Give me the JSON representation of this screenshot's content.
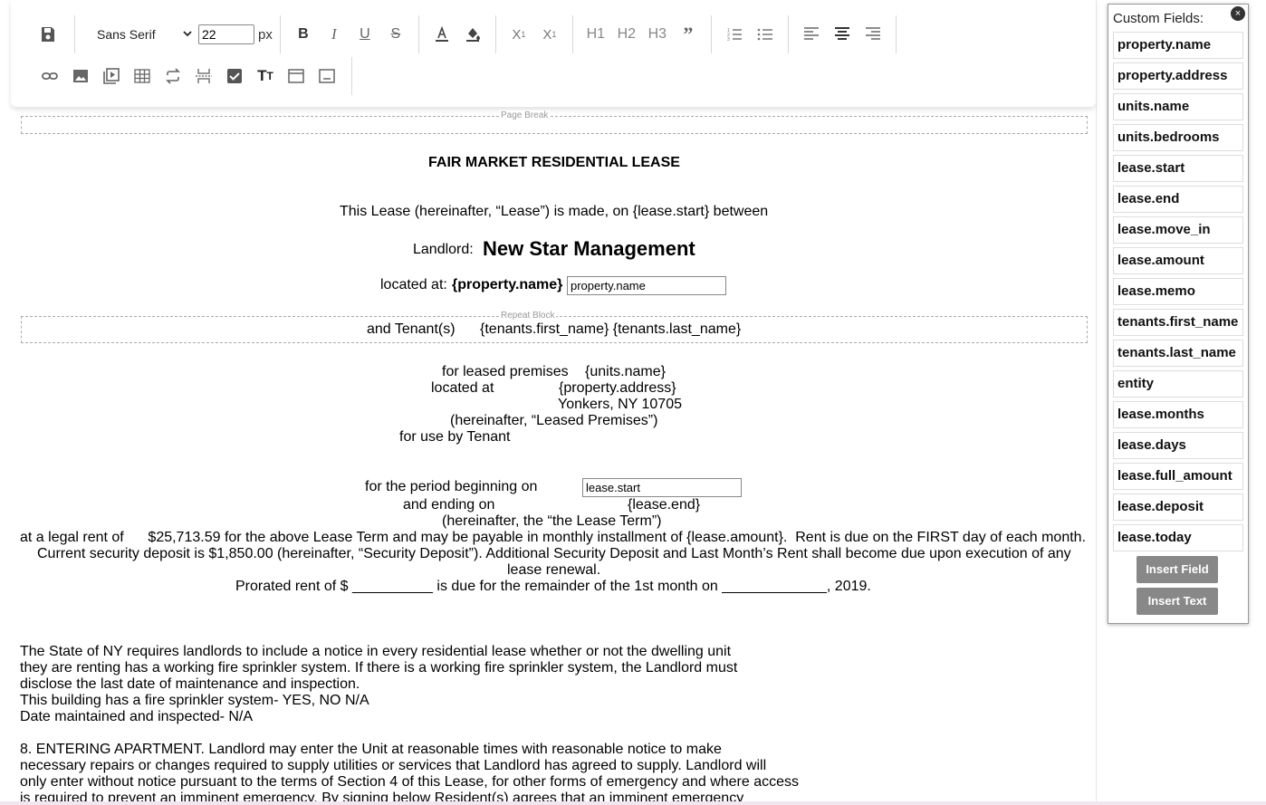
{
  "toolbar": {
    "font_family": "Sans Serif",
    "font_size": "22",
    "font_unit": "px",
    "headings": [
      "H1",
      "H2",
      "H3"
    ]
  },
  "document": {
    "page_break_label": "Page Break",
    "repeat_block_label": "Repeat Block",
    "title": "FAIR MARKET RESIDENTIAL LEASE",
    "intro": "This Lease (hereinafter, “Lease”) is made, on {lease.start} between",
    "landlord_label": "Landlord:",
    "landlord_name": "New Star Management",
    "located_at_label": "located at:",
    "located_at_value": "{property.name}",
    "field_property_name": "property.name",
    "tenants_label": "and Tenant(s)",
    "tenants_value": "{tenants.first_name} {tenants.last_name}",
    "premises_label": "for leased premises",
    "premises_value": "{units.name}",
    "premises_located_label": "located at",
    "premises_address": "{property.address}",
    "premises_city": "Yonkers, NY 10705",
    "premises_hereinafter": "(hereinafter, “Leased Premises”)",
    "premises_use": "for use by Tenant",
    "period_label": "for the period beginning on",
    "field_lease_start": "lease.start",
    "ending_label": "and ending on",
    "ending_value": "{lease.end}",
    "term_hereinafter": "(hereinafter, the “the Lease Term”)",
    "rent_line": "at a legal rent of      $25,713.59 for the above Lease Term and may be payable in monthly installment of {lease.amount}.  Rent is due on the FIRST day of each month.",
    "deposit_line": "Current security deposit is $1,850.00 (hereinafter, “Security Deposit”). Additional Security Deposit and Last Month’s Rent shall become due upon execution of any",
    "deposit_line2": "lease renewal.",
    "prorated_line": "Prorated rent of $ __________ is due for the remainder of the 1st month on _____________, 2019.",
    "sprinkler": [
      "The State of NY requires landlords to include a notice in every residential lease whether or not the dwelling unit",
      "they are renting has a working fire sprinkler system. If there is a working fire sprinkler system, the Landlord must",
      "disclose the last date of maintenance and inspection.",
      "This building has a fire sprinkler system- YES, NO N/A",
      "Date maintained and inspected- N/A"
    ],
    "entering": [
      "8. ENTERING APARTMENT. Landlord may enter the Unit at reasonable times with reasonable notice to make",
      "necessary repairs or changes required to supply utilities or services that Landlord has agreed to supply. Landlord will",
      "only enter without notice pursuant to the terms of Section 4 of this Lease, for other forms of emergency and where access",
      "is required to prevent an imminent emergency. By signing below Resident(s) agrees that an imminent emergency"
    ]
  },
  "custom_fields": {
    "title": "Custom Fields:",
    "close": "×",
    "items": [
      "property.name",
      "property.address",
      "units.name",
      "units.bedrooms",
      "lease.start",
      "lease.end",
      "lease.move_in",
      "lease.amount",
      "lease.memo",
      "tenants.first_name",
      "tenants.last_name",
      "entity",
      "lease.months",
      "lease.days",
      "lease.full_amount",
      "lease.deposit",
      "lease.today"
    ],
    "insert_field": "Insert Field",
    "insert_text": "Insert Text"
  }
}
